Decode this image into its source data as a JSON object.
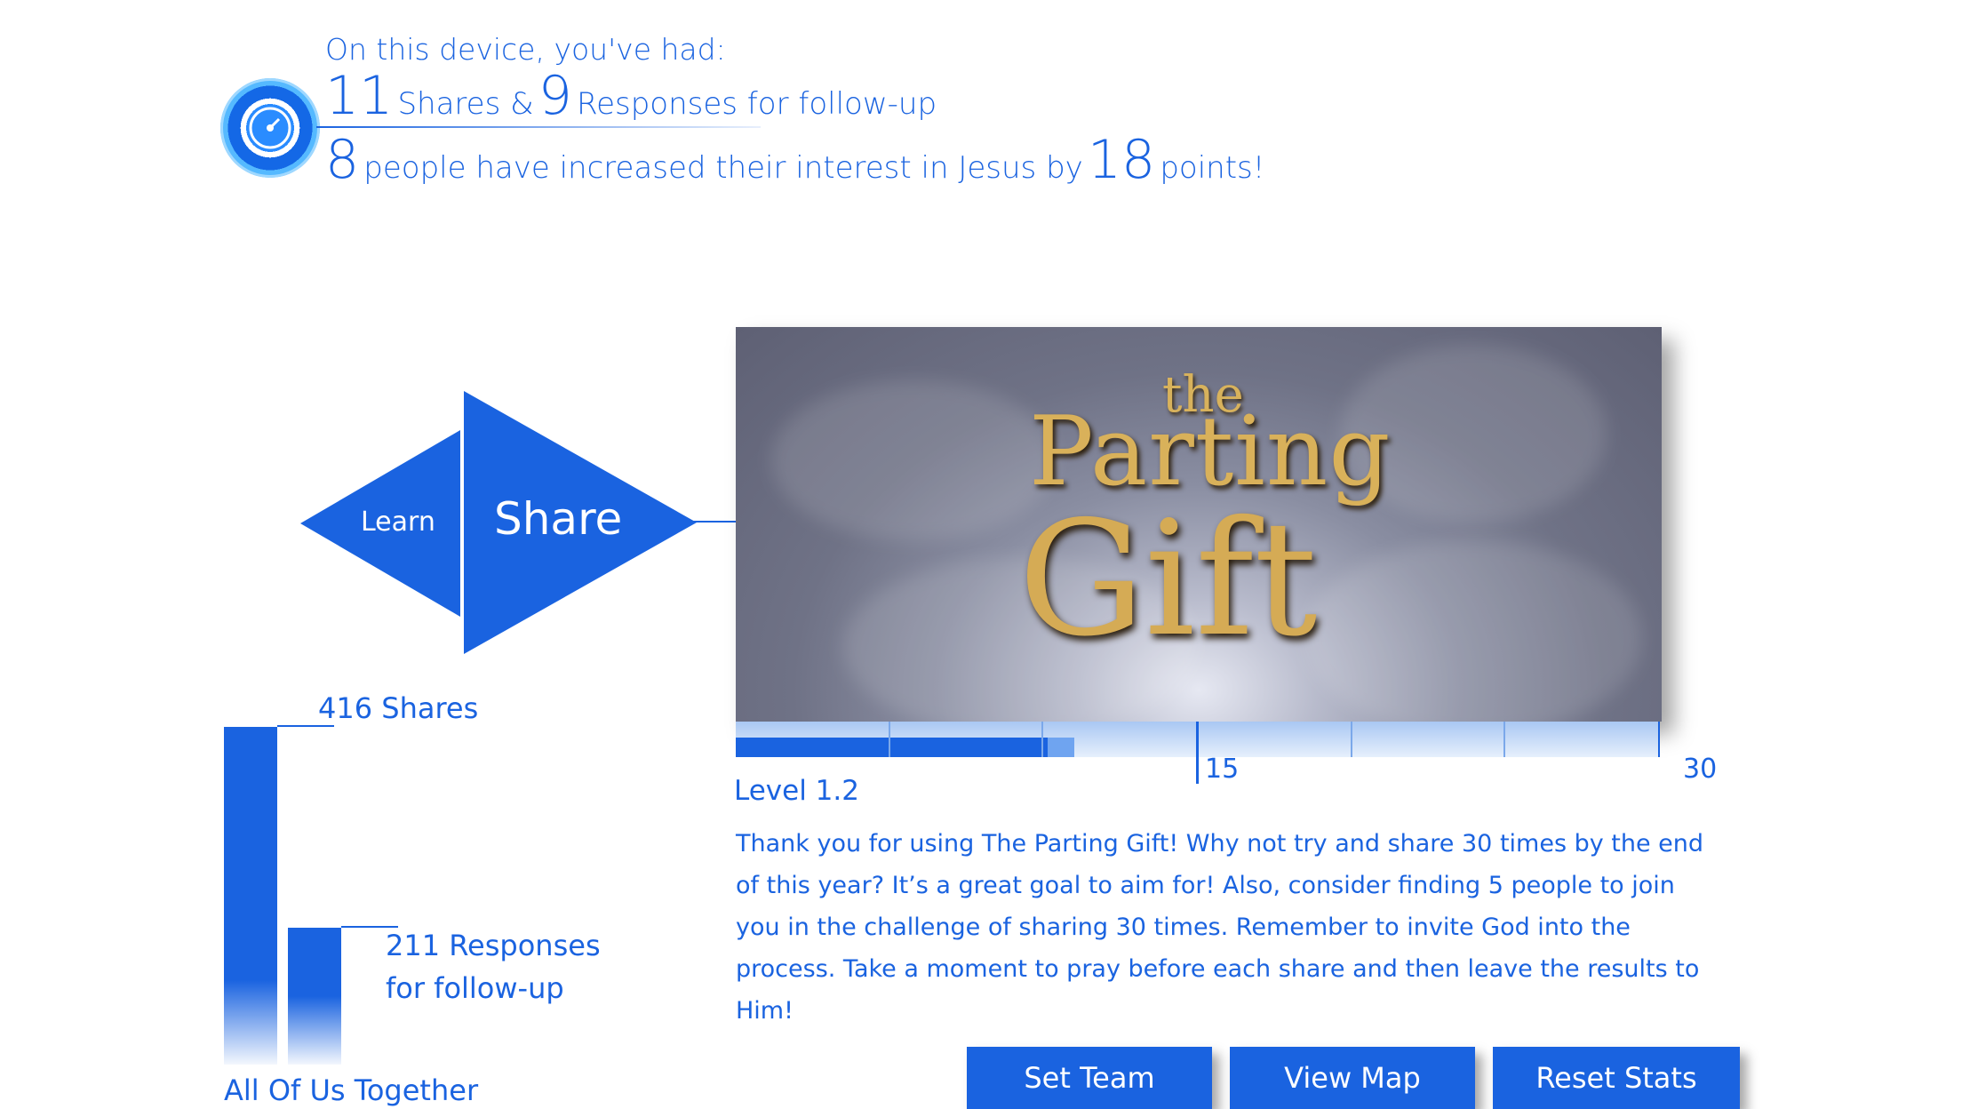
{
  "device_stats": {
    "intro": "On this device, you've had:",
    "shares_count": "11",
    "shares_text": "Shares &",
    "responses_count": "9",
    "responses_text": "Responses for follow-up",
    "people_count": "8",
    "interest_text": "people have increased their interest in Jesus by",
    "points_count": "18",
    "points_text": "points!"
  },
  "nav": {
    "learn_label": "Learn",
    "share_label": "Share"
  },
  "video": {
    "title_line1": "the",
    "title_line2": "Parting",
    "title_line3": "Gift"
  },
  "progress": {
    "level_label": "Level 1.2",
    "marker_mid": "15",
    "marker_end": "30",
    "current_shares": 11,
    "max_shares": 30
  },
  "message": "Thank you for using The Parting Gift! Why not try and share 30 times by the end of this year? It’s a great goal to aim for! Also, consider finding 5 people to join you in the challenge of sharing 30 times. Remember to invite God into the process. Take a moment to pray before each share and then leave the results to Him!",
  "aggregate": {
    "shares_label": "416 Shares",
    "responses_line1": "211 Responses",
    "responses_line2": "for follow-up",
    "footer_label": "All Of Us Together",
    "shares_value": 416,
    "responses_value": 211
  },
  "buttons": {
    "set_team": "Set Team",
    "view_map": "View Map",
    "reset_stats": "Reset Stats"
  },
  "colors": {
    "accent": "#1a63e0",
    "gauge_light": "#55b9ff",
    "title_gold": "#d9b15a"
  }
}
